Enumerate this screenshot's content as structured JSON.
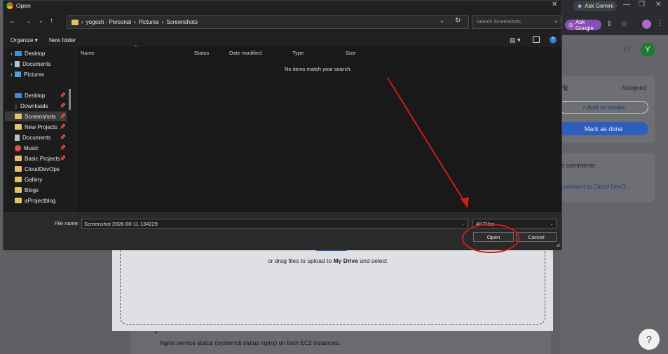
{
  "browser": {
    "gemini_label": "Ask Gemini",
    "ask_google_label": "Ask Google",
    "avatar_letter": "Y"
  },
  "classroom": {
    "card_title_fragment": "rk",
    "status": "Assigned",
    "add_label": "+ Add or create",
    "mark_done_label": "Mark as done",
    "comments_fragment": "e comments",
    "comment_link": "comment to Cloud DevO...",
    "drag_text_prefix": "or drag files to upload to",
    "drag_text_bold": "My Drive",
    "drag_text_suffix": "and select",
    "bullet_text": "Nginx service status (systemctl status nginx) on both EC2 instances."
  },
  "dialog": {
    "title": "Open",
    "breadcrumb": [
      "yogesh - Personal",
      "Pictures",
      "Screenshots"
    ],
    "search_placeholder": "Search Screenshots",
    "toolbar": {
      "organize": "Organize",
      "new_folder": "New folder"
    },
    "columns": [
      "Name",
      "Status",
      "Date modified",
      "Type",
      "Size"
    ],
    "empty_message": "No items match your search.",
    "nav_top": [
      "Desktop",
      "Documents",
      "Pictures"
    ],
    "nav_quick": [
      "Desktop",
      "Downloads",
      "Screenshots",
      "New Projects",
      "Documents",
      "Music",
      "Basic Projects",
      "CloudDevOps",
      "Gallery",
      "Blogs",
      "aProjectblog"
    ],
    "filename_label": "File name:",
    "filename_value": "Screenshot 2026-00-11 134229",
    "filetype_value": "All Files",
    "open_label": "Open",
    "cancel_label": "Cancel"
  },
  "colors": {
    "annotation": "#d11a1a",
    "accent_folder": "#e6c166"
  }
}
